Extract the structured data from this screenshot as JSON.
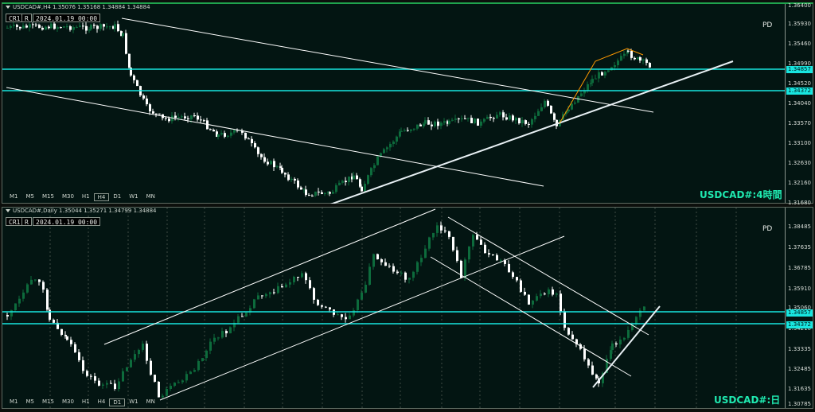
{
  "top": {
    "title": "USDCAD#,H4 1.35076 1.35168 1.34884 1.34884",
    "cr_label": "CR1",
    "r_label": "R",
    "date_box": "2024.01.19 00:00",
    "pd_label": "PD",
    "chart_label": "USDCAD#:4時間",
    "timeframes": [
      "M1",
      "M5",
      "M15",
      "M30",
      "H1",
      "H4",
      "D1",
      "W1",
      "MN"
    ],
    "active_timeframe": "H4",
    "price_ticks": [
      "1.36400",
      "1.35930",
      "1.35460",
      "1.34990",
      "1.34520",
      "1.34040",
      "1.33570",
      "1.33100",
      "1.32630",
      "1.32160",
      "1.31680"
    ],
    "highlight_levels": [
      "1.34857",
      "1.34372"
    ]
  },
  "bottom": {
    "title": "USDCAD#,Daily 1.35044 1.35271 1.34799 1.34884",
    "cr_label": "CR1",
    "r_label": "R",
    "date_box": "2024.01.19 00:00",
    "pd_label": "PD",
    "chart_label": "USDCAD#:日",
    "timeframes": [
      "M1",
      "M5",
      "M15",
      "M30",
      "H1",
      "H4",
      "D1",
      "W1",
      "MN"
    ],
    "active_timeframe": "D1",
    "price_ticks": [
      "1.38485",
      "1.37635",
      "1.36785",
      "1.35910",
      "1.35060",
      "1.34210",
      "1.33335",
      "1.32485",
      "1.31635",
      "1.30785"
    ],
    "highlight_levels": [
      "1.34857",
      "1.34372"
    ]
  },
  "colors": {
    "background": "#031512",
    "bull_candle": "#0d6b3c",
    "bear_candle": "#ffffff",
    "level_line": "#18e6e0",
    "trend_line": "#ffffff",
    "zigzag": "#ff9900",
    "label_text": "#1fe9b0"
  }
}
